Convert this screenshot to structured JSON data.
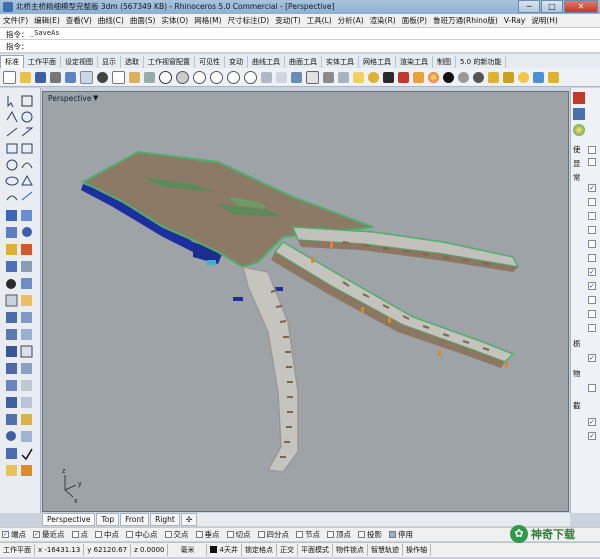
{
  "window": {
    "title": "北桥主桥精细模型完整版 3dm (567349 KB) - Rhinoceros 5.0 Commercial - [Perspective]",
    "minimize": "─",
    "maximize": "□",
    "close": "✕"
  },
  "menu": [
    "文件(F)",
    "编辑(E)",
    "查看(V)",
    "曲线(C)",
    "曲面(S)",
    "实体(O)",
    "网格(M)",
    "尺寸标注(D)",
    "变动(T)",
    "工具(L)",
    "分析(A)",
    "渲染(R)",
    "面板(P)",
    "鲁班万通(Rhino版)",
    "V-Ray",
    "说明(H)"
  ],
  "command": {
    "history_label": "指令：",
    "history_value": "_SaveAs",
    "prompt_label": "指令："
  },
  "toolbar_tabs": [
    "标准",
    "工作平面",
    "设定视图",
    "显示",
    "选取",
    "工作视窗配置",
    "可见性",
    "变动",
    "曲线工具",
    "曲面工具",
    "实体工具",
    "网格工具",
    "渲染工具",
    "制图",
    "5.0 的新功能"
  ],
  "viewport": {
    "label": "Perspective",
    "dropdown": "▼",
    "axis_x": "x",
    "axis_y": "y",
    "axis_z": "z"
  },
  "right_panel": {
    "chars": [
      "使",
      "显",
      "常",
      "栃",
      "物",
      "截"
    ]
  },
  "viewport_tabs": [
    "Perspective",
    "Top",
    "Front",
    "Right",
    "✣"
  ],
  "osnaps": [
    {
      "label": "端点",
      "checked": true
    },
    {
      "label": "最近点",
      "checked": true
    },
    {
      "label": "点",
      "checked": false
    },
    {
      "label": "中点",
      "checked": false
    },
    {
      "label": "中心点",
      "checked": false
    },
    {
      "label": "交点",
      "checked": false
    },
    {
      "label": "垂点",
      "checked": false
    },
    {
      "label": "切点",
      "checked": false
    },
    {
      "label": "四分点",
      "checked": false
    },
    {
      "label": "节点",
      "checked": false
    },
    {
      "label": "顶点",
      "checked": false
    },
    {
      "label": "投影",
      "checked": false
    },
    {
      "label": "停用",
      "checked": false
    }
  ],
  "status": {
    "cplane": "工作平面",
    "x": "x -16431.13",
    "y": "y 62120.67",
    "z": "z 0.0000",
    "unit": "毫米",
    "layer": "4天井",
    "grid_snap": "锁定格点",
    "ortho": "正交",
    "planar": "平面模式",
    "osnap": "物件锁点",
    "smarttrack": "智慧轨迹",
    "gumball": "操作轴"
  },
  "watermark": {
    "logo": "✿",
    "text": "神奇下载"
  },
  "colors": {
    "viewport_bg": "#9ea3a8",
    "deck_surface": "#8c7a66",
    "green_edge": "#4fae6b",
    "blue_structure": "#1c2fa0",
    "rail_grey": "#c4c4c4"
  }
}
